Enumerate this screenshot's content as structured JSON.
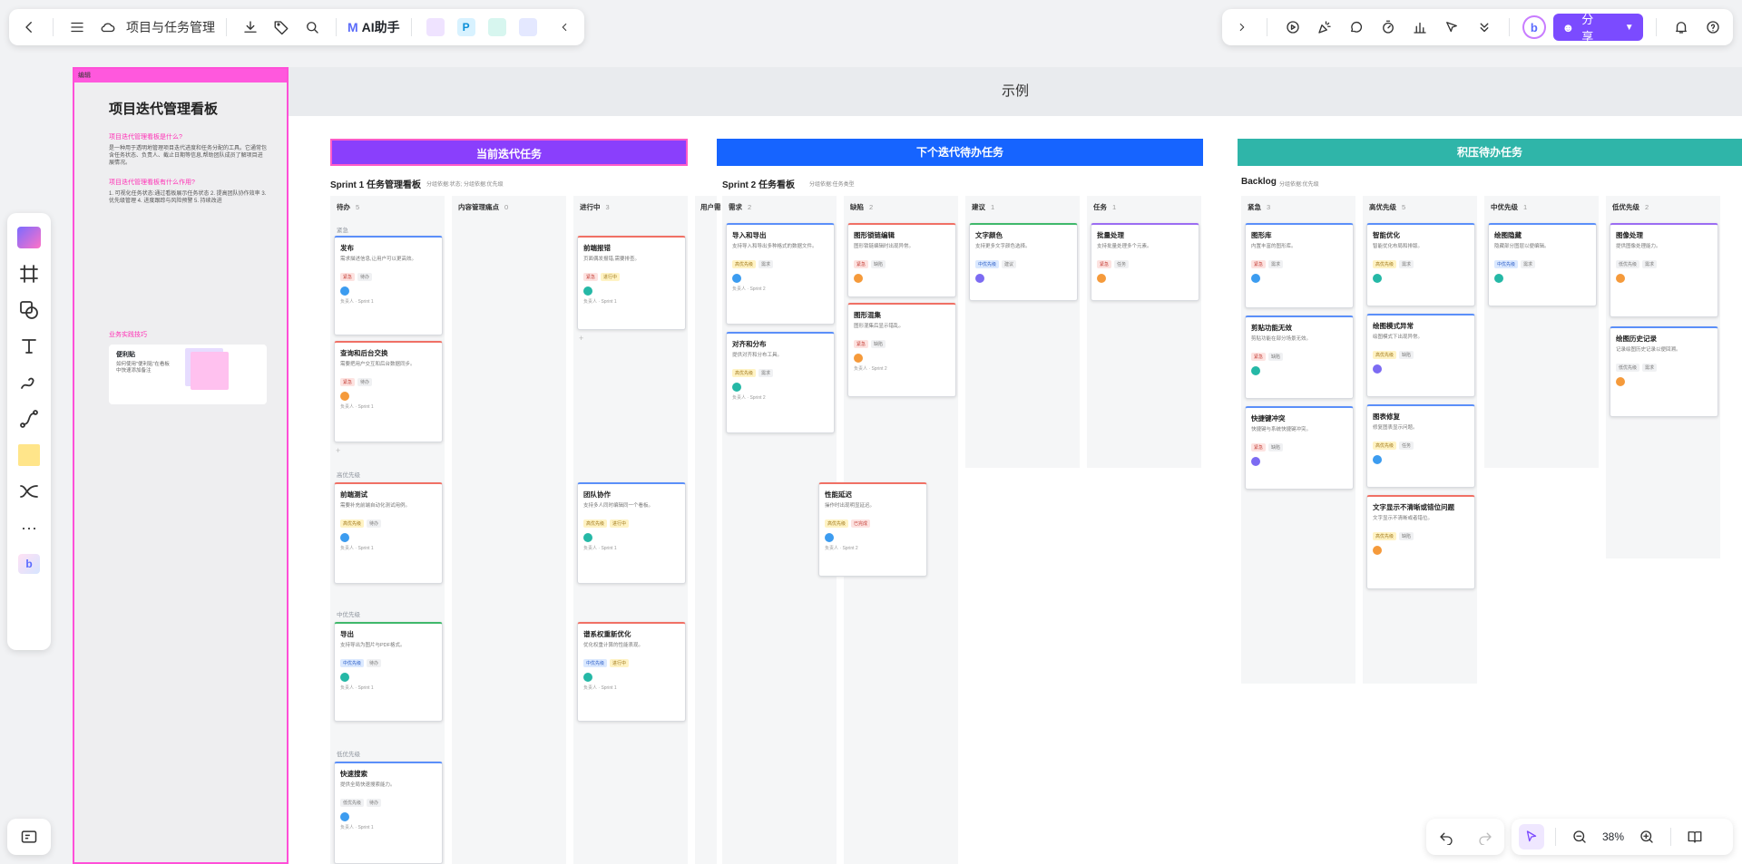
{
  "toolbar": {
    "title": "项目与任务管理",
    "ai_label": "AI助手",
    "share_label": "分享",
    "zoom": "38%"
  },
  "guide": {
    "header": "编辑",
    "title": "项目迭代管理看板",
    "q1": "项目迭代管理看板是什么?",
    "a1": "是一种用于透明地管理项目迭代进度和任务分配的工具。它通常包含任务状态、负责人、截止日期等信息,帮助团队成员了解项目进展情况。",
    "q2": "项目迭代管理看板有什么作用?",
    "a2": "1. 可视化任务状态:通过看板展示任务状态 2. 提高团队协作效率 3. 优先级管理 4. 进度跟踪与风险预警 5. 持续改进",
    "tip_hd": "业务实践技巧",
    "tip_t": "便利贴",
    "tip_d": "如何使用\"便利贴\"在看板中快速添加备注"
  },
  "canvas": {
    "example_title": "示例"
  },
  "sections": {
    "current": "当前迭代任务",
    "next": "下个迭代待办任务",
    "backlog": "积压待办任务"
  },
  "boards": {
    "s1": "Sprint 1 任务管理看板",
    "s2": "Sprint 2 任务看板",
    "bl": "Backlog",
    "filter1": "分组依据:状态; 分组依据:优先级",
    "filter2": "分组依据:任务类型",
    "filter3": "分组依据:优先级"
  },
  "s1cols": [
    {
      "name": "待办",
      "n": "5"
    },
    {
      "name": "内容管理痛点",
      "n": "0"
    },
    {
      "name": "进行中",
      "n": "3"
    },
    {
      "name": "用户需",
      "n": ""
    }
  ],
  "s1groups": [
    "紧急",
    "高优先级",
    "中优先级",
    "低优先级"
  ],
  "s2cols": [
    {
      "name": "需求",
      "n": "2"
    },
    {
      "name": "缺陷",
      "n": "2"
    },
    {
      "name": "建议",
      "n": "1"
    },
    {
      "name": "任务",
      "n": "1"
    }
  ],
  "blcols": [
    {
      "name": "紧急",
      "n": "3"
    },
    {
      "name": "高优先级",
      "n": "5"
    },
    {
      "name": "中优先级",
      "n": "1"
    },
    {
      "name": "低优先级",
      "n": "2"
    }
  ],
  "cards": {
    "c1": "发布",
    "c2": "查询和后台交换",
    "c3": "前端报错",
    "c4": "团队协作",
    "c5": "导出",
    "c6": "谱系权重新优化",
    "c7": "快速搜索",
    "c8": "前端测试",
    "c9": "导入和导出",
    "c10": "对齐和分布",
    "c11": "图形锁链编辑",
    "c12": "图形混集",
    "c13": "性能延迟",
    "c14": "文字颜色",
    "c15": "批量处理",
    "c16": "图形库",
    "c17": "智能优化",
    "c18": "绘图隐藏",
    "c19": "图像处理",
    "c20": "剪贴功能无效",
    "c21": "绘图模式异常",
    "c22": "快捷键冲突",
    "c23": "图表修复",
    "c24": "文字显示不清晰或错位问题",
    "c25": "绘图历史记录"
  }
}
